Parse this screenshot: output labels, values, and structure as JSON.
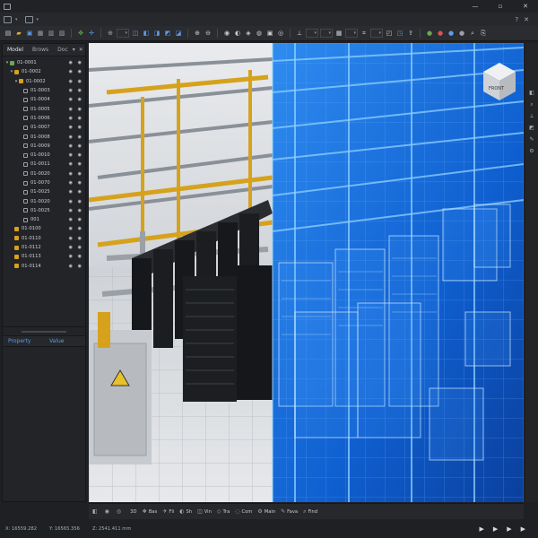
{
  "window": {
    "min": "—",
    "max": "▫",
    "close": "✕"
  },
  "panel": {
    "tabs": [
      "Model",
      "Brows",
      "Doc"
    ],
    "controls": [
      "✕"
    ],
    "tree": [
      {
        "label": "01-0001",
        "depth": 0,
        "exp": "▾",
        "color": "green"
      },
      {
        "label": "01-0002",
        "depth": 1,
        "exp": "▾",
        "color": "yellow"
      },
      {
        "label": "01-0002",
        "depth": 2,
        "exp": "▾",
        "color": "yellow"
      },
      {
        "label": "01-0003",
        "depth": 3,
        "exp": "",
        "color": "grey"
      },
      {
        "label": "01-0004",
        "depth": 3,
        "exp": "",
        "color": "grey"
      },
      {
        "label": "01-0005",
        "depth": 3,
        "exp": "",
        "color": "grey"
      },
      {
        "label": "01-0006",
        "depth": 3,
        "exp": "",
        "color": "grey"
      },
      {
        "label": "01-0007",
        "depth": 3,
        "exp": "",
        "color": "grey"
      },
      {
        "label": "01-0008",
        "depth": 3,
        "exp": "",
        "color": "grey"
      },
      {
        "label": "01-0009",
        "depth": 3,
        "exp": "",
        "color": "grey"
      },
      {
        "label": "01-0010",
        "depth": 3,
        "exp": "",
        "color": "grey"
      },
      {
        "label": "01-0011",
        "depth": 3,
        "exp": "",
        "color": "grey"
      },
      {
        "label": "01-0020",
        "depth": 3,
        "exp": "",
        "color": "grey"
      },
      {
        "label": "01-0070",
        "depth": 3,
        "exp": "",
        "color": "grey"
      },
      {
        "label": "01-0025",
        "depth": 3,
        "exp": "",
        "color": "grey"
      },
      {
        "label": "01-0020",
        "depth": 3,
        "exp": "",
        "color": "grey"
      },
      {
        "label": "01-0025",
        "depth": 3,
        "exp": "",
        "color": "grey"
      },
      {
        "label": "001",
        "depth": 3,
        "exp": "",
        "color": "grey"
      },
      {
        "label": "01-0100",
        "depth": 1,
        "exp": "",
        "color": "yellow"
      },
      {
        "label": "01-0110",
        "depth": 1,
        "exp": "",
        "color": "yellow"
      },
      {
        "label": "01-0112",
        "depth": 1,
        "exp": "",
        "color": "yellow"
      },
      {
        "label": "01-0113",
        "depth": 1,
        "exp": "",
        "color": "yellow"
      },
      {
        "label": "01-0114",
        "depth": 1,
        "exp": "",
        "color": "yellow"
      }
    ],
    "property_header": "Property",
    "value_header": "Value"
  },
  "bottombar": [
    {
      "icon": "◧",
      "label": ""
    },
    {
      "icon": "◉",
      "label": ""
    },
    {
      "icon": "◎",
      "label": ""
    },
    {
      "icon": "",
      "label": "3D"
    },
    {
      "icon": "❖",
      "label": "Bas"
    },
    {
      "icon": "✈",
      "label": "Fli"
    },
    {
      "icon": "◐",
      "label": "Sh"
    },
    {
      "icon": "◫",
      "label": "Vin"
    },
    {
      "icon": "◇",
      "label": "Tra"
    },
    {
      "icon": "◌",
      "label": "Com"
    },
    {
      "icon": "⚙",
      "label": "Main"
    },
    {
      "icon": "✎",
      "label": "Fava"
    },
    {
      "icon": "⌕",
      "label": "Find"
    }
  ],
  "status": {
    "x": "X:  16559.282",
    "y": "Y:  16565.356",
    "z": "Z:  2541.411 mm"
  },
  "playback": [
    "▶",
    "▶",
    "▶",
    "▶"
  ],
  "colors": {
    "accent": "#5e9be8",
    "xray": "#1d6fe0"
  }
}
